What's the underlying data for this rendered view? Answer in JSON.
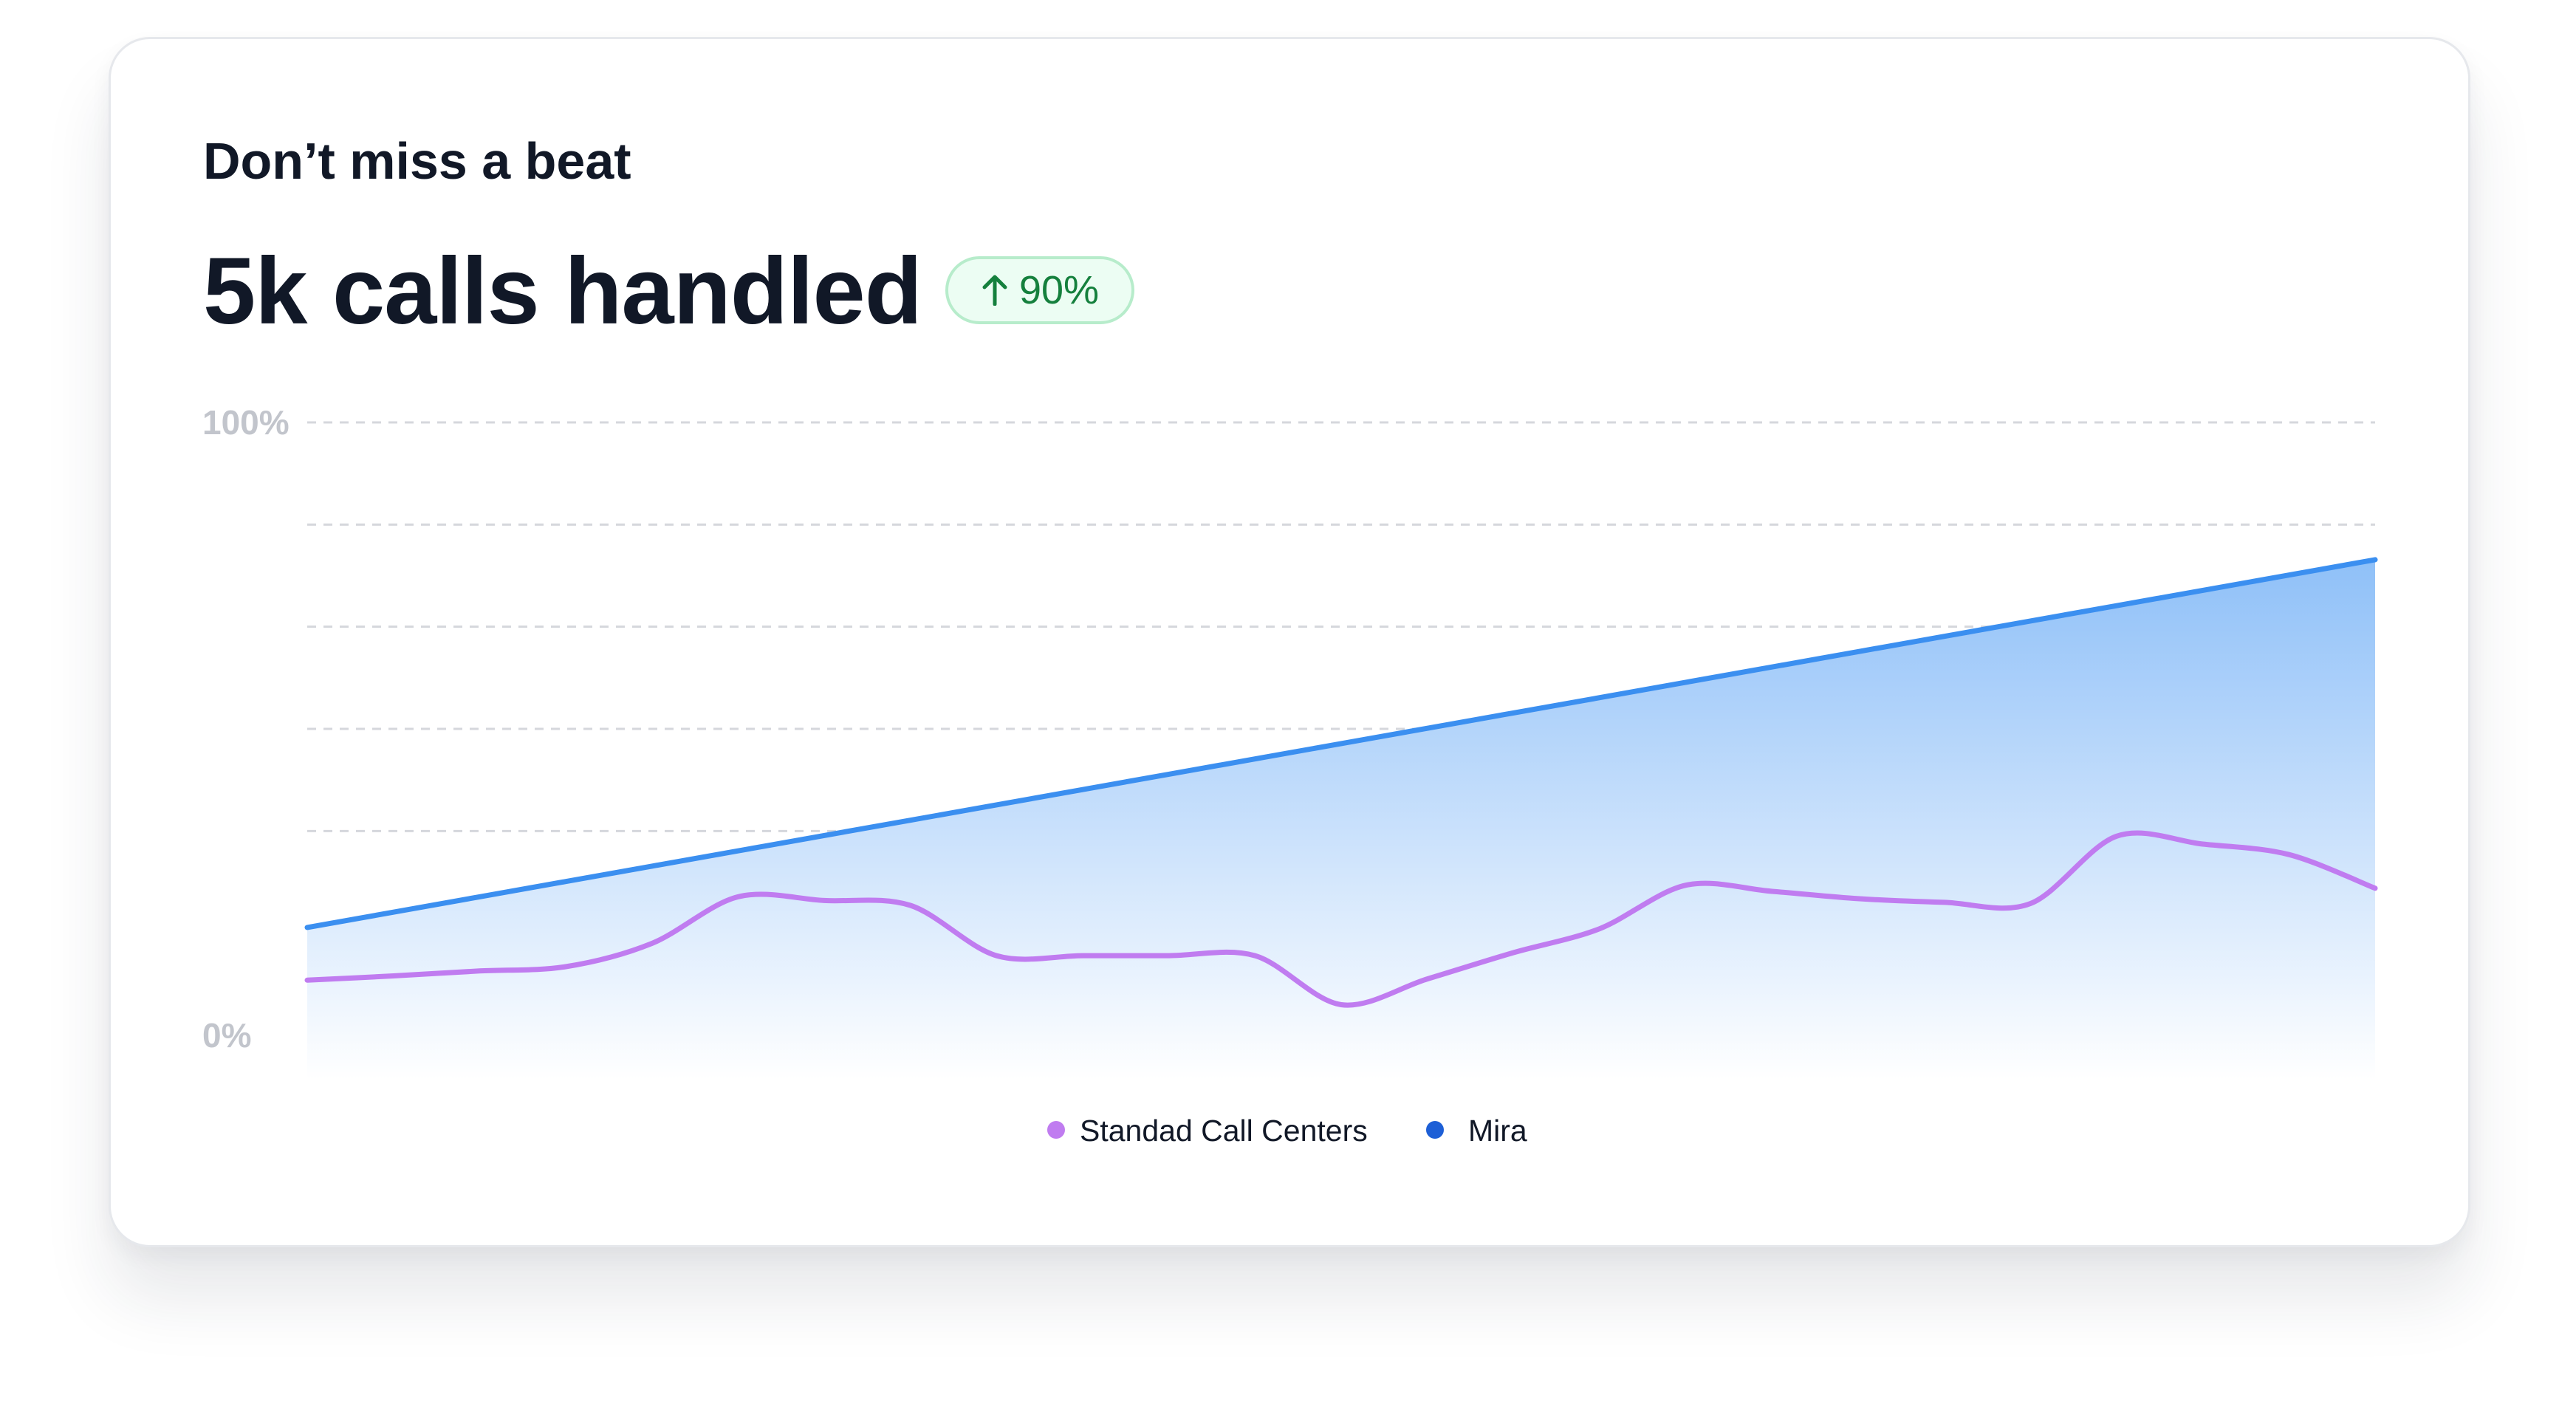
{
  "card": {
    "kicker": "Don’t miss a beat",
    "headline": "5k calls handled",
    "badge": {
      "icon": "arrow-up-icon",
      "value": "90%"
    }
  },
  "chart_data": {
    "type": "area",
    "ylim": [
      0,
      100
    ],
    "y_tick_labels": [
      "100%",
      "0%"
    ],
    "grid": true,
    "legend_position": "bottom-center",
    "x": [
      0,
      1,
      2,
      3,
      4,
      5,
      6,
      7,
      8,
      9,
      10,
      11,
      12,
      13,
      14,
      15,
      16,
      17,
      18,
      19,
      20,
      21,
      22,
      23,
      24
    ],
    "series": [
      {
        "name": "Standad Call Centers",
        "type": "line",
        "color": "#c07cf0",
        "values": [
          9,
          9.7,
          10.5,
          11.2,
          15,
          22.6,
          22,
          21.2,
          13,
          13,
          13,
          13,
          5,
          9.2,
          13.5,
          17.4,
          24.5,
          23.5,
          22.3,
          21.7,
          21.5,
          32.5,
          31.2,
          29.5,
          24
        ]
      },
      {
        "name": "Mira",
        "type": "area",
        "color": "#3b8ff0",
        "values": [
          17.6,
          20.1,
          22.6,
          25.1,
          27.6,
          30.1,
          32.6,
          35.1,
          37.6,
          40.1,
          42.6,
          45.1,
          47.6,
          50.1,
          52.6,
          55.1,
          57.6,
          60.1,
          62.6,
          65.1,
          67.6,
          70.1,
          72.6,
          75.1,
          77.6
        ]
      }
    ],
    "colors": {
      "mira_legend_dot": "#1d5fd6",
      "area_top": "#8fc0f8",
      "area_bottom": "#ffffff",
      "grid": "#d5d7dc",
      "badge_text": "#15803d"
    }
  }
}
